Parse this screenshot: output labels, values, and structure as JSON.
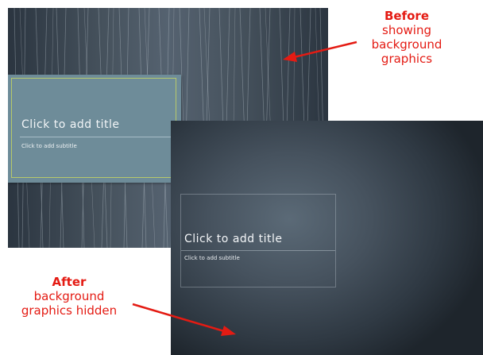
{
  "before_slide": {
    "title_placeholder": "Click to add title",
    "subtitle_placeholder": "Click to add subtitle"
  },
  "after_slide": {
    "title_placeholder": "Click to add title",
    "subtitle_placeholder": "Click to add subtitle"
  },
  "annotations": {
    "before": {
      "heading": "Before",
      "lines": [
        "showing",
        "background",
        "graphics"
      ]
    },
    "after": {
      "heading": "After",
      "lines": [
        "background",
        "graphics hidden"
      ]
    }
  },
  "colors": {
    "annotation_red": "#e41b13",
    "title_box_fill": "#6e8c99",
    "title_box_frame": "#b7c96a",
    "slide_dark": "#2f3943"
  }
}
